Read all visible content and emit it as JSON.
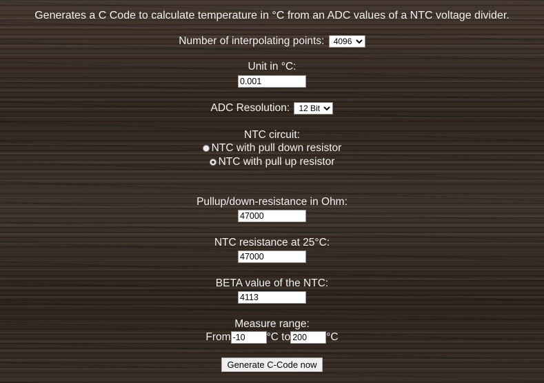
{
  "header": {
    "description": "Generates a C Code to calculate temperature in °C from an ADC values of a NTC voltage divider."
  },
  "interpolation": {
    "label": "Number of interpolating points:",
    "selected": "4096"
  },
  "unit": {
    "label": "Unit in °C:",
    "value": "0.001"
  },
  "adc": {
    "label": "ADC Resolution:",
    "selected": "12 Bit"
  },
  "circuit": {
    "label": "NTC circuit:",
    "options": [
      {
        "label": "NTC with pull down resistor",
        "checked": false
      },
      {
        "label": "NTC with pull up resistor",
        "checked": true
      }
    ]
  },
  "pull_resistance": {
    "label": "Pullup/down-resistance in Ohm:",
    "value": "47000"
  },
  "ntc_resistance": {
    "label": "NTC resistance at 25°C:",
    "value": "47000"
  },
  "beta": {
    "label": "BETA value of the NTC:",
    "value": "4113"
  },
  "range": {
    "label": "Measure range:",
    "from_label": "From",
    "from_value": "-10",
    "to_label": "°C to",
    "to_value": "200",
    "unit": "°C"
  },
  "generate": {
    "label": "Generate C-Code now"
  }
}
